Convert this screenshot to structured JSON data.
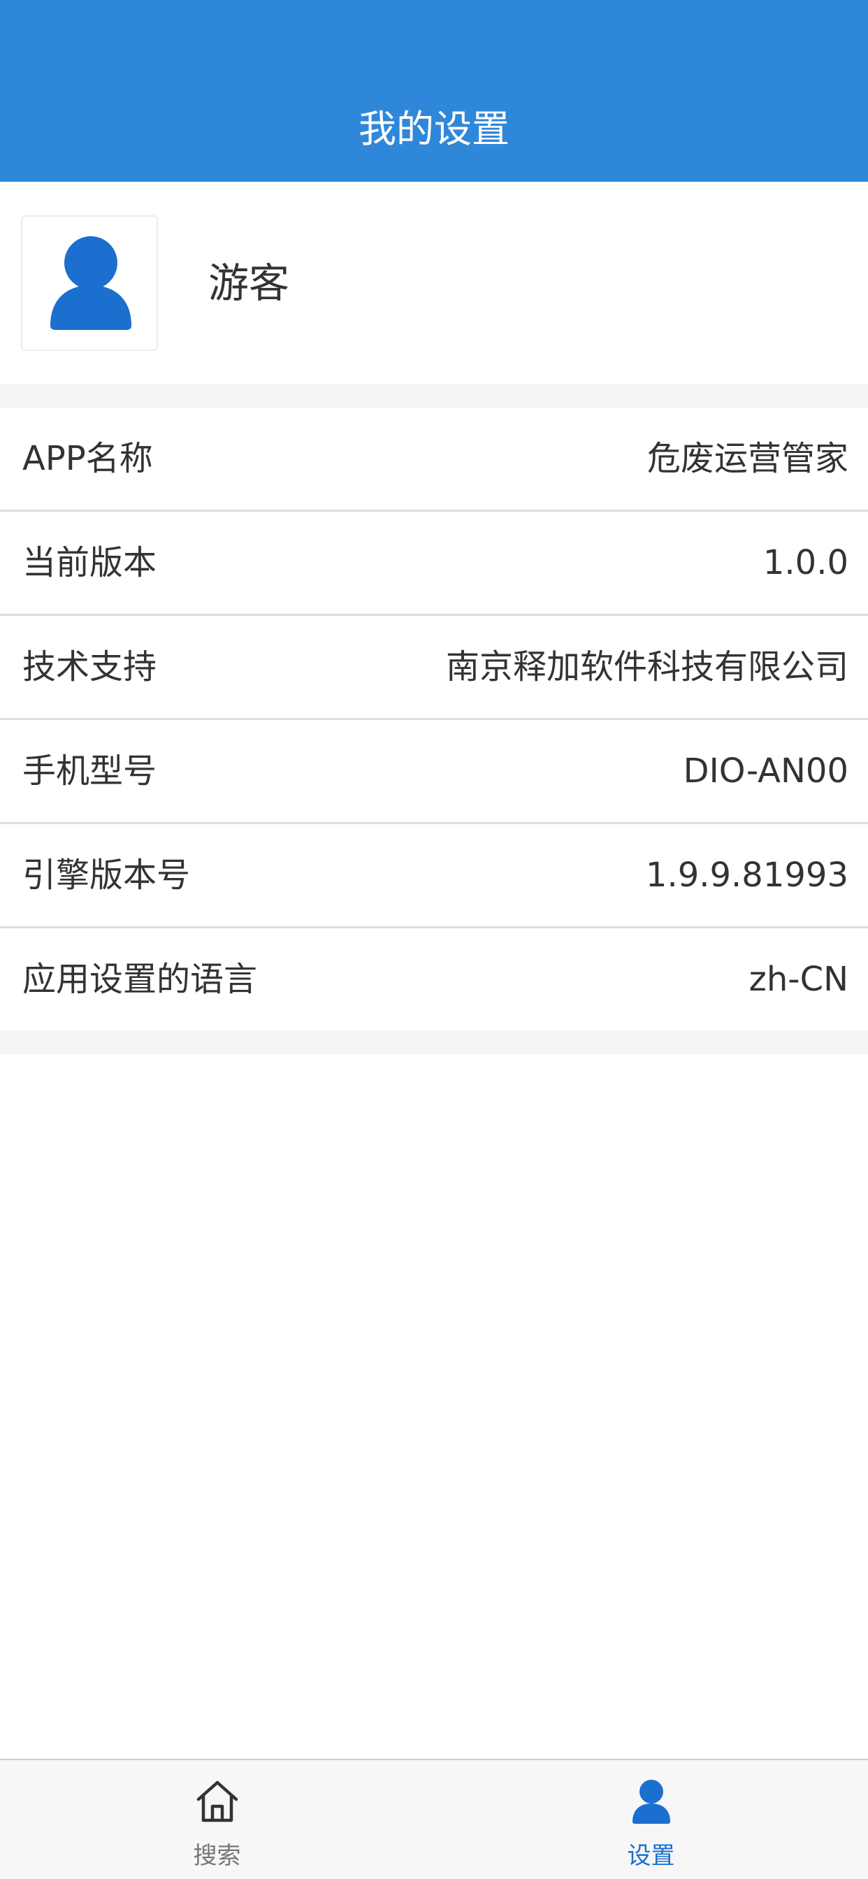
{
  "header": {
    "title": "我的设置"
  },
  "profile": {
    "avatar_icon": "user-icon",
    "user_name": "游客"
  },
  "info_rows": [
    {
      "label": "APP名称",
      "value": "危废运营管家"
    },
    {
      "label": "当前版本",
      "value": "1.0.0"
    },
    {
      "label": "技术支持",
      "value": "南京释加软件科技有限公司"
    },
    {
      "label": "手机型号",
      "value": "DIO-AN00"
    },
    {
      "label": "引擎版本号",
      "value": "1.9.9.81993"
    },
    {
      "label": "应用设置的语言",
      "value": "zh-CN"
    }
  ],
  "tabbar": {
    "items": [
      {
        "label": "搜索",
        "icon": "home-icon",
        "active": false
      },
      {
        "label": "设置",
        "icon": "user-icon",
        "active": true
      }
    ]
  },
  "colors": {
    "header_bg": "#2f87d9",
    "active_tab": "#1a6fd1",
    "inactive_tab": "#777777"
  }
}
